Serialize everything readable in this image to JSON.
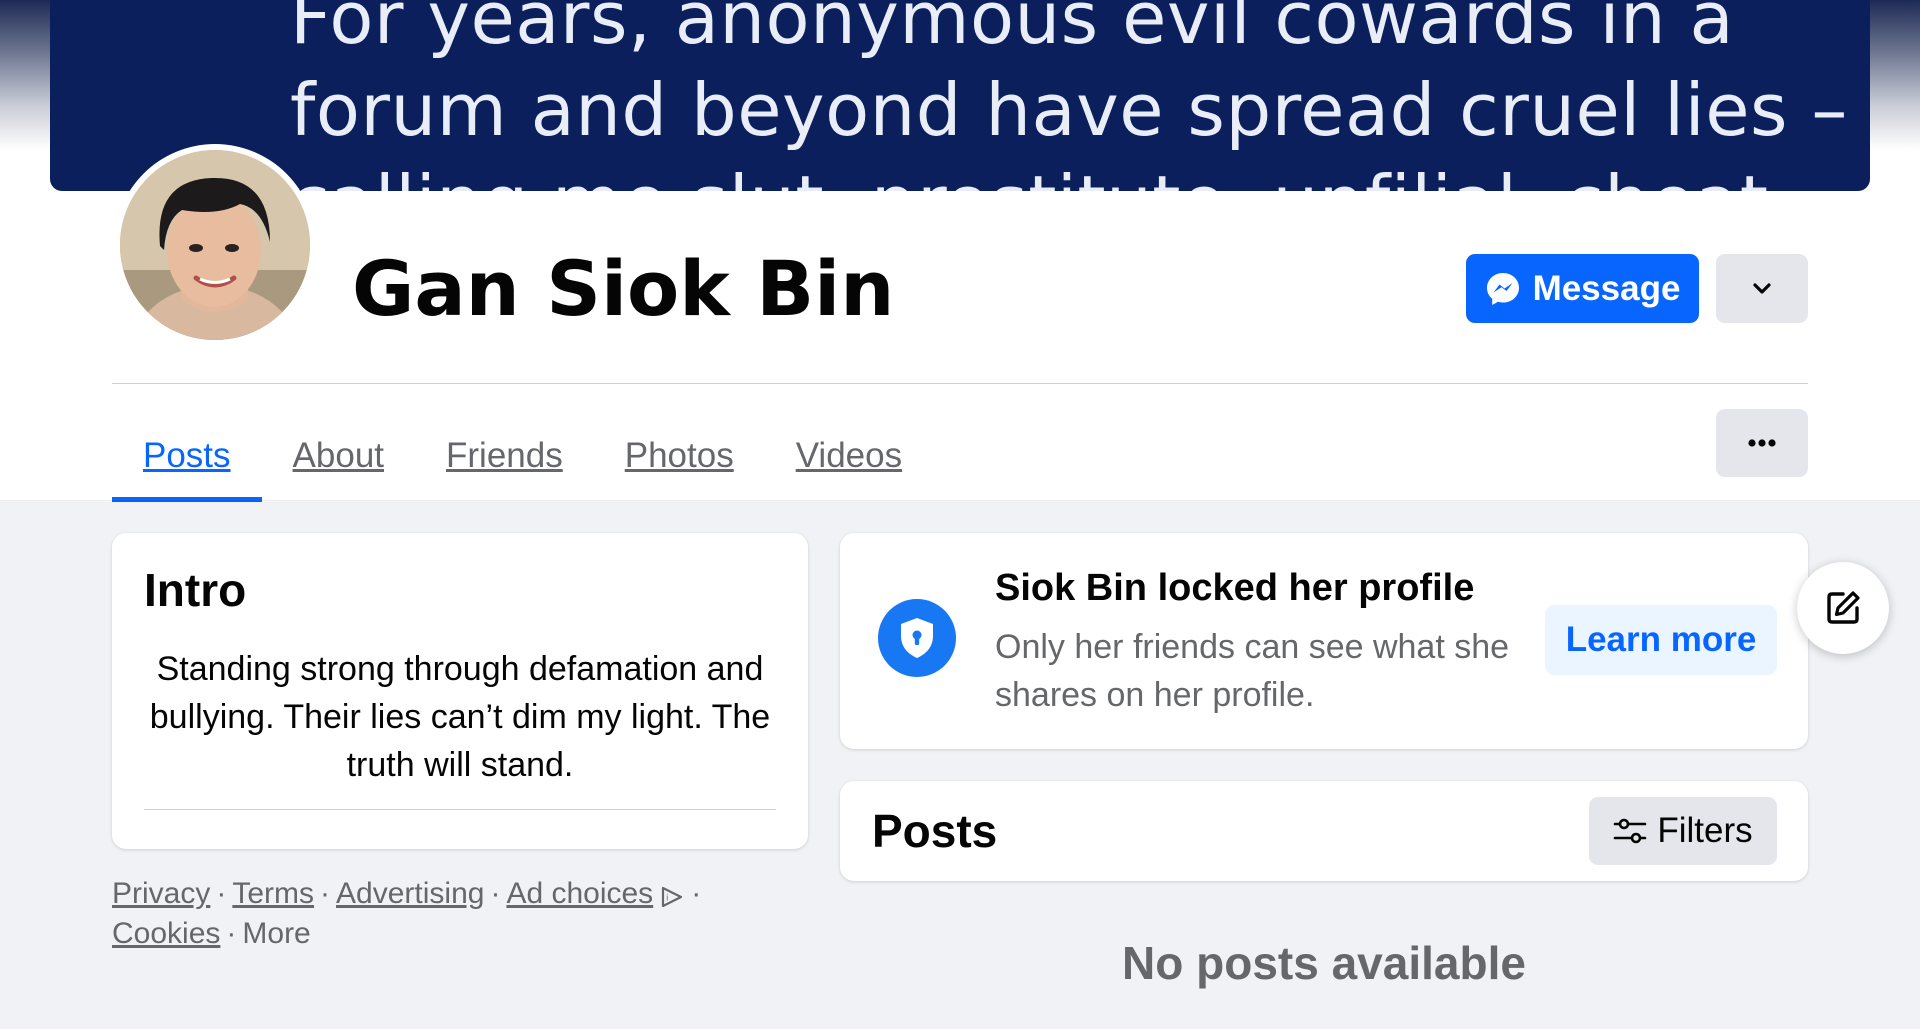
{
  "cover": {
    "text": "For years, anonymous evil cowards in a\nforum and beyond have spread cruel lies –\ncalling me slut, prostitute, unfilial, cheat"
  },
  "profile": {
    "name": "Gan Siok Bin"
  },
  "actions": {
    "message_label": "Message",
    "message_icon": "messenger-icon",
    "dropdown_icon": "chevron-down-icon",
    "more_icon": "ellipsis-icon"
  },
  "tabs": [
    {
      "label": "Posts",
      "active": true
    },
    {
      "label": "About"
    },
    {
      "label": "Friends"
    },
    {
      "label": "Photos"
    },
    {
      "label": "Videos"
    }
  ],
  "intro": {
    "title": "Intro",
    "bio": "Standing strong through defamation and bullying. Their lies can’t dim my light. The truth will stand."
  },
  "footer": {
    "privacy": "Privacy",
    "terms": "Terms",
    "advertising": "Advertising",
    "ad_choices": "Ad choices",
    "cookies": "Cookies",
    "more": "More",
    "separator": "·"
  },
  "locked": {
    "title": "Siok Bin locked her profile",
    "description": "Only her friends can see what she shares on her profile.",
    "learn_more": "Learn more",
    "icon": "shield-lock-icon"
  },
  "posts": {
    "title": "Posts",
    "filters_label": "Filters",
    "empty_text": "No posts available"
  },
  "colors": {
    "accent": "#0866ff",
    "cover_bg": "#0a1f5c",
    "page_bg": "#f0f2f5",
    "secondary_text": "#65676b"
  }
}
